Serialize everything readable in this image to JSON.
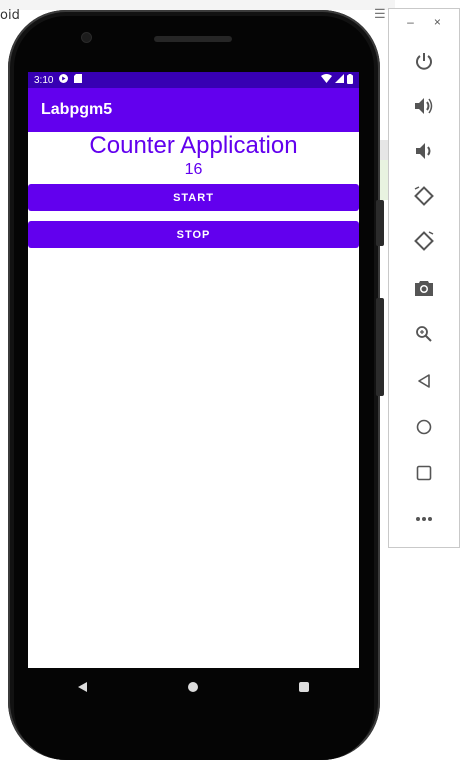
{
  "background": {
    "left_text": "oid",
    "right_icon": "menu-icon"
  },
  "status_bar": {
    "time": "3:10",
    "left_icons": [
      "play-store-icon",
      "sd-card-icon"
    ],
    "right_icons": [
      "wifi-icon",
      "signal-icon",
      "battery-icon"
    ]
  },
  "app_bar": {
    "title": "Labpgm5"
  },
  "main": {
    "title": "Counter Application",
    "counter_value": "16",
    "start_label": "START",
    "stop_label": "STOP"
  },
  "nav_bar": {
    "buttons": [
      "back-icon",
      "home-icon",
      "recents-icon"
    ]
  },
  "toolbar": {
    "minimize_label": "–",
    "close_label": "×",
    "buttons": [
      "power-icon",
      "volume-up-icon",
      "volume-down-icon",
      "rotate-left-icon",
      "rotate-right-icon",
      "camera-icon",
      "zoom-icon",
      "back-icon",
      "home-icon",
      "overview-icon",
      "more-icon"
    ]
  },
  "colors": {
    "primary": "#6200EE",
    "primary_dark": "#3700B3",
    "phone_body": "#121212"
  }
}
